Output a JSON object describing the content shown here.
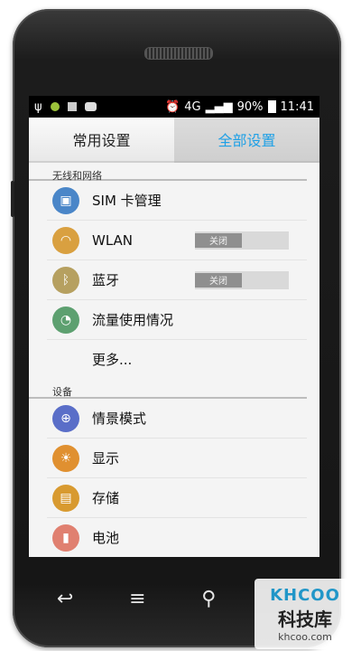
{
  "status": {
    "network": "4G",
    "battery": "90%",
    "time": "11:41"
  },
  "tabs": [
    {
      "label": "常用设置"
    },
    {
      "label": "全部设置"
    }
  ],
  "sections": {
    "wireless": "无线和网络",
    "device": "设备"
  },
  "wireless_items": [
    {
      "label": "SIM 卡管理",
      "icon": "sim-icon",
      "color": "#4a86c8"
    },
    {
      "label": "WLAN",
      "icon": "wifi-icon",
      "color": "#d9a040",
      "toggle": "关闭"
    },
    {
      "label": "蓝牙",
      "icon": "bluetooth-icon",
      "color": "#b6a060",
      "toggle": "关闭"
    },
    {
      "label": "流量使用情况",
      "icon": "data-usage-icon",
      "color": "#5da070"
    },
    {
      "label": "更多..."
    }
  ],
  "device_items": [
    {
      "label": "情景模式",
      "icon": "profile-icon",
      "color": "#5a6ec8"
    },
    {
      "label": "显示",
      "icon": "display-icon",
      "color": "#e09030"
    },
    {
      "label": "存储",
      "icon": "storage-icon",
      "color": "#d89a30"
    },
    {
      "label": "电池",
      "icon": "battery-icon",
      "color": "#e08070"
    }
  ],
  "navbar": {
    "back": "↩",
    "menu": "≡",
    "search": "⚲"
  },
  "watermark": {
    "logo": "KHCOO",
    "name": "科技库",
    "url": "khcoo.com"
  },
  "colors": {
    "accent": "#1ea0e6",
    "toggle_off": "#8f8f8f"
  }
}
